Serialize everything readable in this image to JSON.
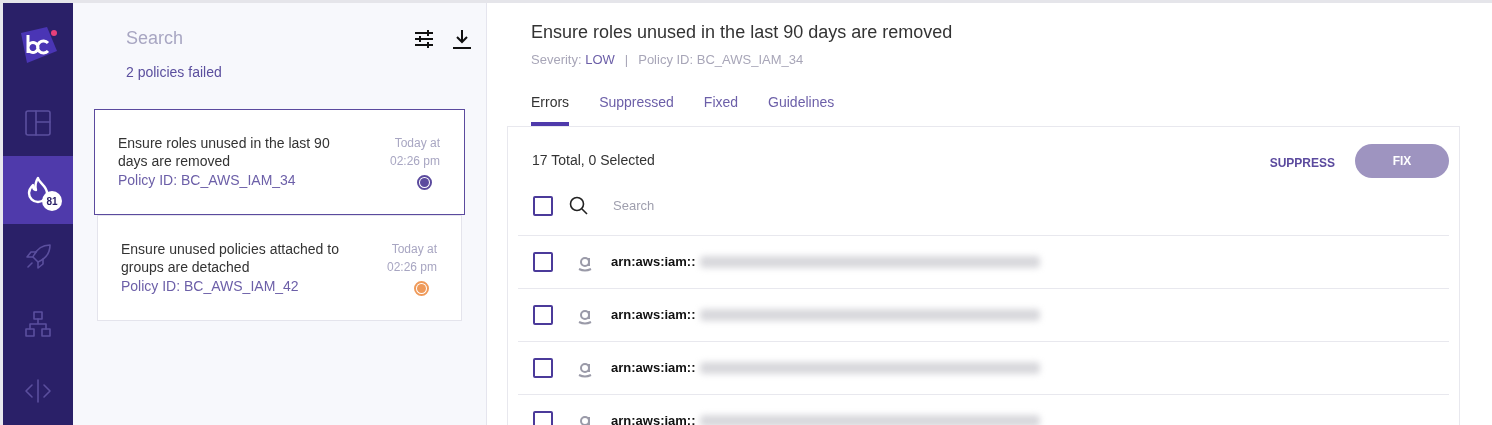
{
  "sidebar": {
    "items": [
      {
        "kind": "dashboard",
        "selected": false
      },
      {
        "kind": "flame",
        "selected": true,
        "badge": "81"
      },
      {
        "kind": "rocket",
        "selected": false
      },
      {
        "kind": "hierarchy",
        "selected": false
      },
      {
        "kind": "code",
        "selected": false
      }
    ]
  },
  "policy_list": {
    "search": {
      "placeholder": "Search"
    },
    "summary": "2 policies failed",
    "policies": [
      {
        "title": "Ensure roles unused in the last 90 days are removed",
        "policy_id": "Policy ID: BC_AWS_IAM_34",
        "time": "Today at 02:26 pm",
        "selected": true,
        "color": "#5b4a9e"
      },
      {
        "title": "Ensure unused policies attached to groups are detached",
        "policy_id": "Policy ID: BC_AWS_IAM_42",
        "time": "Today at 02:26 pm",
        "selected": false,
        "color": "#ef9a5a"
      }
    ]
  },
  "detail": {
    "title": "Ensure roles unused in the last 90 days are removed",
    "severity_label": "Severity:",
    "severity": "LOW",
    "separator": "|",
    "policy_id": "Policy ID: BC_AWS_IAM_34",
    "tabs": [
      {
        "label": "Errors",
        "selected": true
      },
      {
        "label": "Suppressed",
        "selected": false
      },
      {
        "label": "Fixed",
        "selected": false
      },
      {
        "label": "Guidelines",
        "selected": false
      }
    ],
    "total": "17 Total, 0 Selected",
    "buttons": {
      "suppress": "SUPPRESS",
      "fix": "FIX"
    },
    "select_all": {
      "checked": false
    },
    "search": {
      "placeholder": "Search"
    },
    "rows": [
      {
        "resource": "arn:aws:iam::",
        "checked": false
      },
      {
        "resource": "arn:aws:iam::",
        "checked": false
      },
      {
        "resource": "arn:aws:iam::",
        "checked": false
      },
      {
        "resource": "arn:aws:iam::",
        "checked": false
      }
    ]
  }
}
